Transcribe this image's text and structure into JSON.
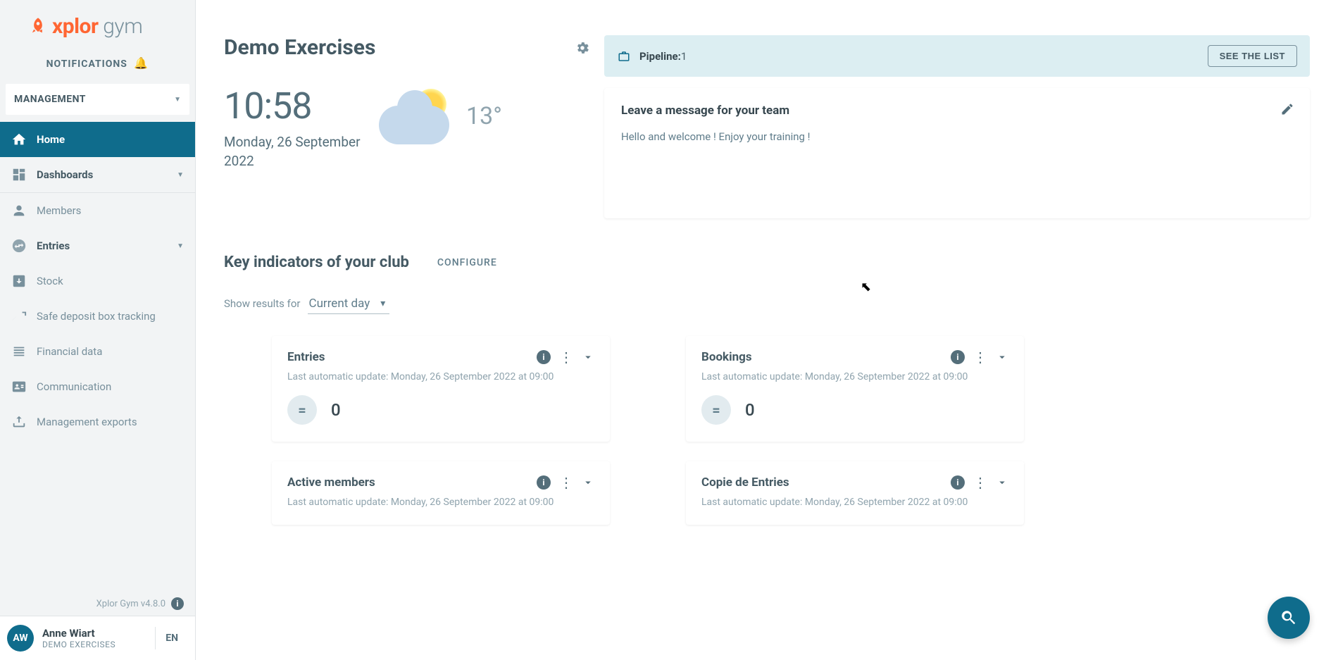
{
  "brand": {
    "name1": "xplor",
    "name2": " gym"
  },
  "notifications_label": "NOTIFICATIONS",
  "management_label": "MANAGEMENT",
  "nav": {
    "home": "Home",
    "dashboards": "Dashboards",
    "members": "Members",
    "entries": "Entries",
    "stock": "Stock",
    "safe": "Safe deposit box tracking",
    "financial": "Financial data",
    "communication": "Communication",
    "exports": "Management exports"
  },
  "version": "Xplor Gym v4.8.0",
  "user": {
    "initials": "AW",
    "name": "Anne Wiart",
    "sub": "DEMO EXERCISES"
  },
  "lang": "EN",
  "page_title": "Demo Exercises",
  "time": "10:58",
  "date": "Monday, 26 September 2022",
  "temperature": "13°",
  "pipeline": {
    "label": "Pipeline:",
    "count": "1",
    "button": "SEE THE LIST"
  },
  "message": {
    "title": "Leave a message for your team",
    "body": "Hello and welcome ! Enjoy your training !"
  },
  "indicators": {
    "title": "Key indicators of your club",
    "configure": "CONFIGURE",
    "filter_label": "Show results for",
    "filter_value": "Current day",
    "update_prefix": "Last automatic update: Monday, 26 September 2022 at 09:00",
    "cards": [
      {
        "title": "Entries",
        "value": "0"
      },
      {
        "title": "Bookings",
        "value": "0"
      },
      {
        "title": "Active members",
        "value": ""
      },
      {
        "title": "Copie de Entries",
        "value": ""
      }
    ]
  }
}
